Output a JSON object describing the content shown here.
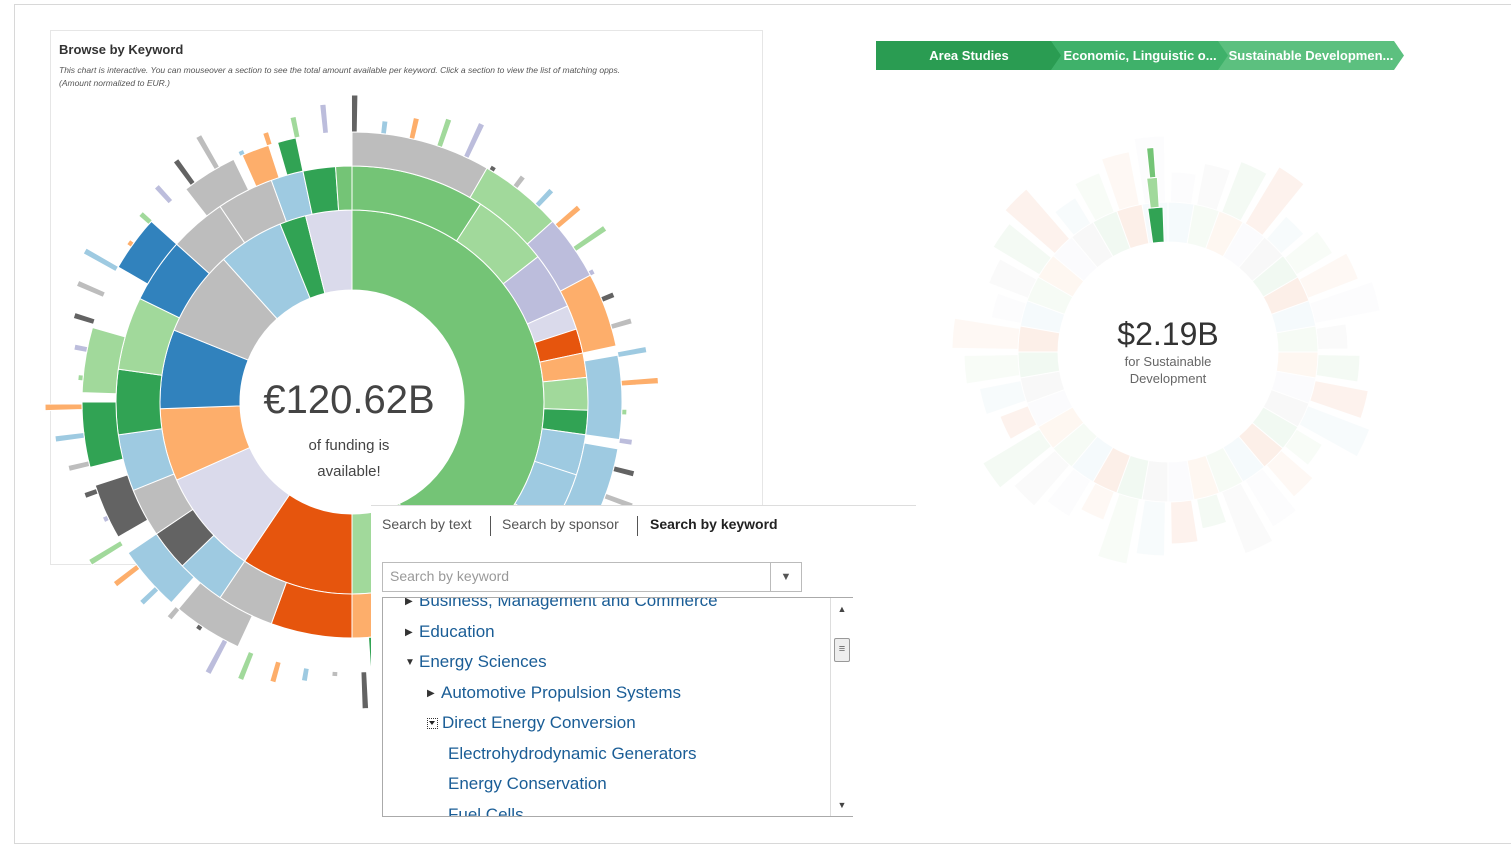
{
  "chart_card": {
    "title": "Browse by Keyword",
    "description_line1": "This chart is interactive. You can mouseover a section to see the total amount available per keyword. Click a section to view the list of matching opps.",
    "description_line2": "(Amount normalized to EUR.)",
    "center_amount": "€120.62B",
    "center_line1": "of funding is",
    "center_line2": "available!"
  },
  "breadcrumb": {
    "items": [
      {
        "label": "Area Studies",
        "color": "#2a9c52"
      },
      {
        "label": "Economic, Linguistic o...",
        "color": "#3fb16a"
      },
      {
        "label": "Sustainable Developmen...",
        "color": "#5cc07f"
      }
    ]
  },
  "zoomed_chart": {
    "amount": "$2.19B",
    "sub_line1": "for Sustainable",
    "sub_line2": "Development"
  },
  "search": {
    "tabs": [
      {
        "label": "Search by text",
        "active": false
      },
      {
        "label": "Search by sponsor",
        "active": false
      },
      {
        "label": "Search by keyword",
        "active": true
      }
    ],
    "placeholder": "Search by keyword",
    "dropdown_icon": "chevron-down-icon"
  },
  "tree": {
    "items": [
      {
        "label": "Business, Management and Commerce",
        "state": "collapsed"
      },
      {
        "label": "Education",
        "state": "collapsed"
      },
      {
        "label": "Energy Sciences",
        "state": "expanded"
      },
      {
        "label": "Automotive Propulsion Systems",
        "state": "collapsed"
      },
      {
        "label": "Direct Energy Conversion",
        "state": "expanded-checkbox"
      },
      {
        "label": "Electrohydrodynamic Generators",
        "state": "leaf"
      },
      {
        "label": "Energy Conservation",
        "state": "leaf"
      },
      {
        "label": "Fuel Cells",
        "state": "leaf"
      }
    ]
  },
  "colors": {
    "green": "#74c476",
    "green_dark": "#31a354",
    "green_light": "#a1d99b",
    "orange": "#e6550d",
    "orange_light": "#fdae6b",
    "blue": "#3182bd",
    "blue_light": "#9ecae1",
    "grey": "#bdbdbd",
    "grey_dark": "#636363",
    "purple": "#bcbddc",
    "purple_light": "#dadaeb",
    "link": "#1a5d96"
  }
}
